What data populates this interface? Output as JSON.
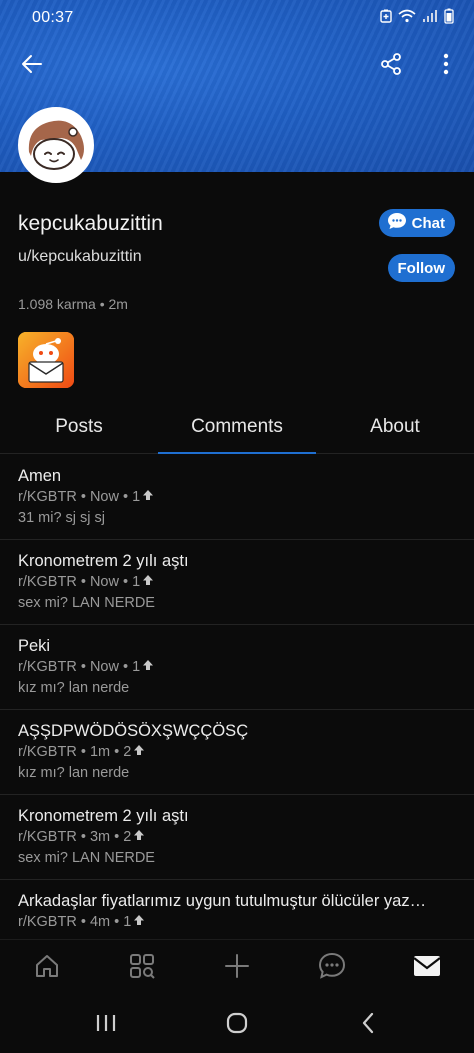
{
  "status_bar": {
    "time": "00:37"
  },
  "profile": {
    "username": "kepcukabuzittin",
    "handle": "u/kepcukabuzittin",
    "karma_line": "1.098 karma • 2m",
    "chat_label": "Chat",
    "follow_label": "Follow"
  },
  "tabs": [
    {
      "label": "Posts"
    },
    {
      "label": "Comments"
    },
    {
      "label": "About"
    }
  ],
  "active_tab": "Comments",
  "comments": [
    {
      "title": "Amen",
      "meta": "r/KGBTR • Now • 1",
      "body": "31 mi? sj sj sj"
    },
    {
      "title": "Kronometrem 2 yılı aştı",
      "meta": "r/KGBTR • Now • 1",
      "body": "sex mi? LAN NERDE"
    },
    {
      "title": "Peki",
      "meta": "r/KGBTR • Now • 1",
      "body": "kız mı? lan nerde"
    },
    {
      "title": "AŞŞDPWÖDÖSÖXŞWÇÇÖSÇ",
      "meta": "r/KGBTR • 1m • 2",
      "body": "kız mı? lan nerde"
    },
    {
      "title": "Kronometrem 2 yılı aştı",
      "meta": "r/KGBTR • 3m • 2",
      "body": "sex mi? LAN NERDE"
    },
    {
      "title": "Arkadaşlar fiyatlarımız uygun tutulmuştur ölücüler yaz…",
      "meta": "r/KGBTR • 4m • 1",
      "body": ""
    }
  ],
  "colors": {
    "accent": "#1f6fd1",
    "banner": "#2165cb",
    "background": "#0b0b0b"
  },
  "icons": {
    "back": "arrow-left-icon",
    "share": "share-icon",
    "more": "more-vertical-icon",
    "chat": "chat-bubble-icon",
    "upvote": "upvote-arrow-icon",
    "nav": [
      "home-icon",
      "communities-icon",
      "plus-icon",
      "chat-icon",
      "inbox-mail-icon"
    ],
    "system": [
      "recents-icon",
      "home-circle-icon",
      "back-chevron-icon"
    ]
  }
}
